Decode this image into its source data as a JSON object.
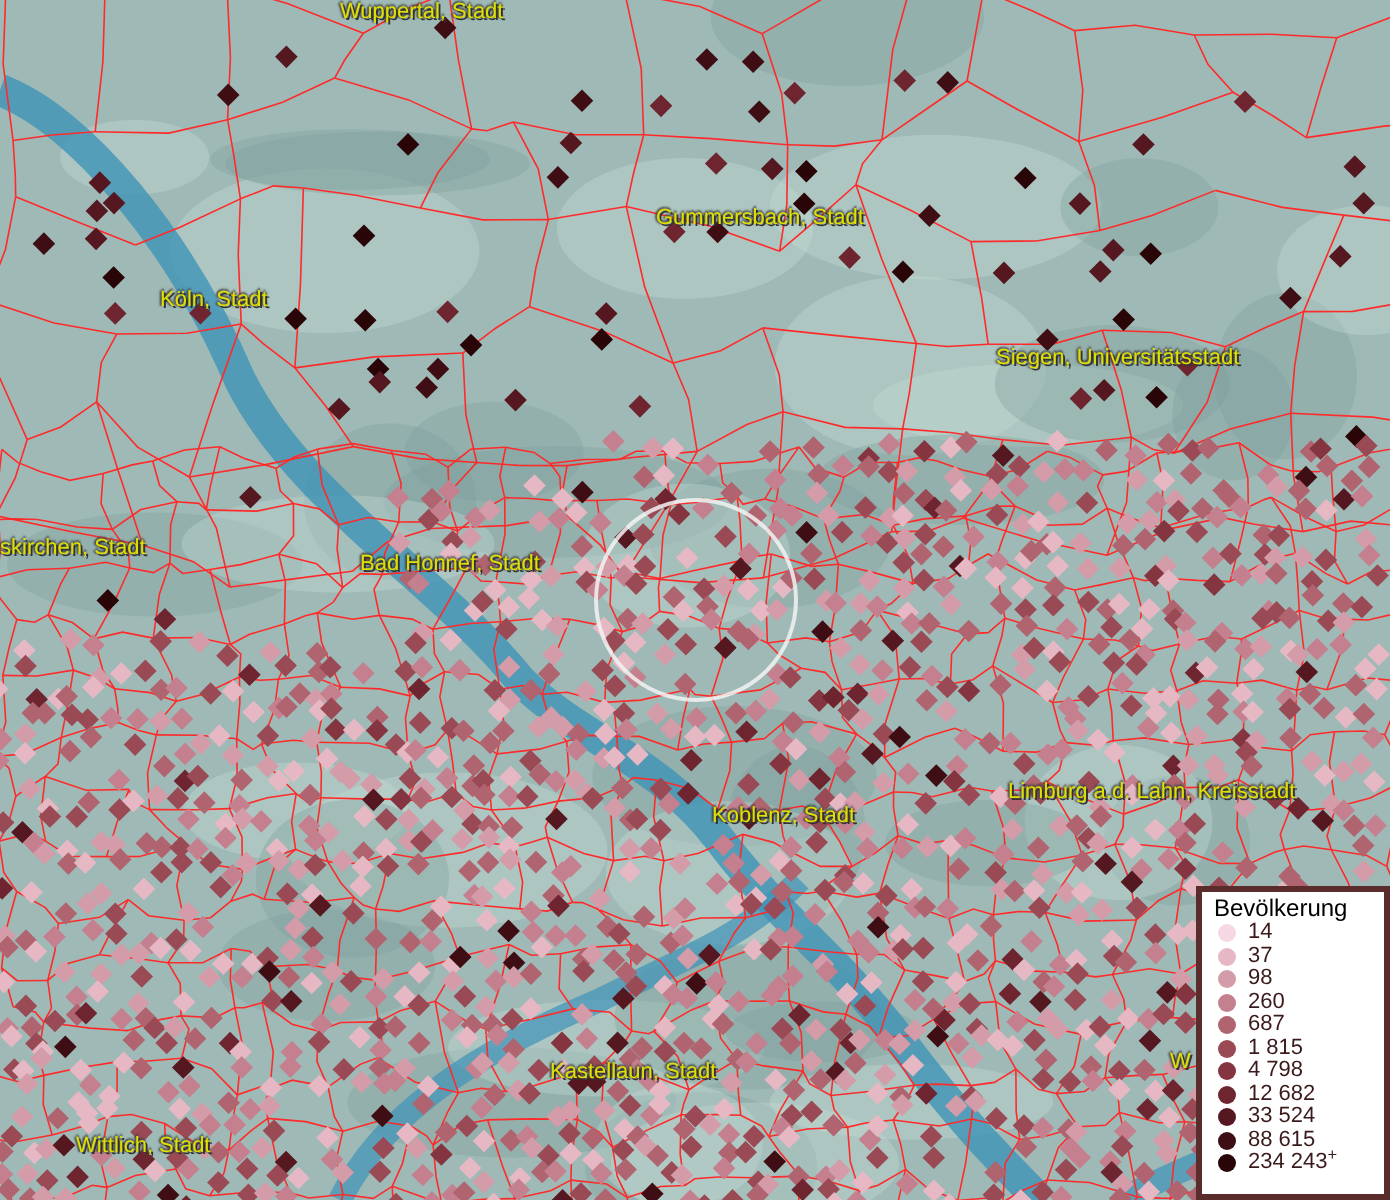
{
  "map": {
    "place_labels": [
      "Wuppertal, Stadt",
      "Köln, Stadt",
      "Gummersbach, Stadt",
      "Siegen, Universitätsstadt",
      "skirchen, Stadt",
      "Bad Honnef, Stadt",
      "Koblenz, Stadt",
      "Limburg a.d. Lahn, Kreisstadt",
      "Kastellaun, Stadt",
      "Wittlich, Stadt",
      "W"
    ]
  },
  "legend": {
    "title": "Bevölkerung",
    "items": [
      {
        "label": "14",
        "color": "#f5d8e4"
      },
      {
        "label": "37",
        "color": "#e6b8c4"
      },
      {
        "label": "98",
        "color": "#d39ca8"
      },
      {
        "label": "260",
        "color": "#c4808e"
      },
      {
        "label": "687",
        "color": "#b06470"
      },
      {
        "label": "1 815",
        "color": "#9a4a55"
      },
      {
        "label": "4 798",
        "color": "#843540"
      },
      {
        "label": "12 682",
        "color": "#6e2530"
      },
      {
        "label": "33 524",
        "color": "#561820"
      },
      {
        "label": "88 615",
        "color": "#3e0e14"
      },
      {
        "label": "234 243$^{+}$",
        "color": "#2a0508"
      }
    ]
  }
}
